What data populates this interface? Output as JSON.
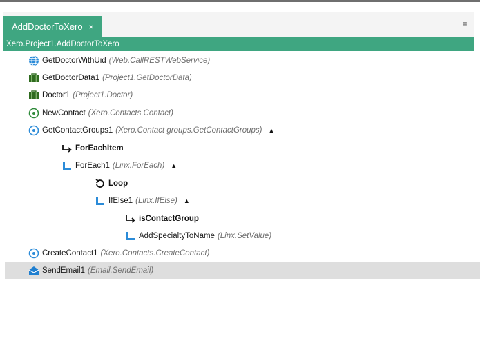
{
  "tab": {
    "title": "AddDoctorToXero",
    "close_glyph": "×"
  },
  "overflow_glyph": "≡",
  "path": "Xero.Project1.AddDoctorToXero",
  "colors": {
    "accent": "#3fa681",
    "icon_blue": "#2b8bd8",
    "icon_green": "#2f6b1f",
    "selected_row": "#dedede"
  },
  "tree": [
    {
      "id": "getdoctorwithuid",
      "icon": "globe-icon",
      "label": "GetDoctorWithUid",
      "type": "(Web.CallRESTWebService)",
      "caret": ""
    },
    {
      "id": "getdoctordata1",
      "icon": "briefcase-icon",
      "label": "GetDoctorData1",
      "type": "(Project1.GetDoctorData)",
      "caret": ""
    },
    {
      "id": "doctor1",
      "icon": "briefcase-icon",
      "label": "Doctor1",
      "type": "(Project1.Doctor)",
      "caret": ""
    },
    {
      "id": "newcontact",
      "icon": "green-circle-icon",
      "label": "NewContact",
      "type": "(Xero.Contacts.Contact)",
      "caret": ""
    },
    {
      "id": "getcontactgroups1",
      "icon": "blue-circle-icon",
      "label": "GetContactGroups1",
      "type": "(Xero.Contact groups.GetContactGroups)",
      "caret": "▲"
    },
    {
      "id": "foreachitem",
      "icon": "arrow-hook-icon",
      "label": "ForEachItem",
      "type": "",
      "caret": ""
    },
    {
      "id": "foreach1",
      "icon": "bracket-icon",
      "label": "ForEach1",
      "type": "(Linx.ForEach)",
      "caret": "▲"
    },
    {
      "id": "loop",
      "icon": "loop-icon",
      "label": "Loop",
      "type": "",
      "caret": ""
    },
    {
      "id": "ifelse1",
      "icon": "bracket-icon",
      "label": "IfElse1",
      "type": "(Linx.IfElse)",
      "caret": "▲"
    },
    {
      "id": "iscontactgroup",
      "icon": "arrow-hook-icon",
      "label": "isContactGroup",
      "type": "",
      "caret": ""
    },
    {
      "id": "addspecialtytoname",
      "icon": "bracket-icon",
      "label": "AddSpecialtyToName",
      "type": "(Linx.SetValue)",
      "caret": ""
    },
    {
      "id": "createcontact1",
      "icon": "blue-circle-icon",
      "label": "CreateContact1",
      "type": "(Xero.Contacts.CreateContact)",
      "caret": ""
    },
    {
      "id": "sendemail1",
      "icon": "email-icon",
      "label": "SendEmail1",
      "type": "(Email.SendEmail)",
      "caret": ""
    }
  ]
}
